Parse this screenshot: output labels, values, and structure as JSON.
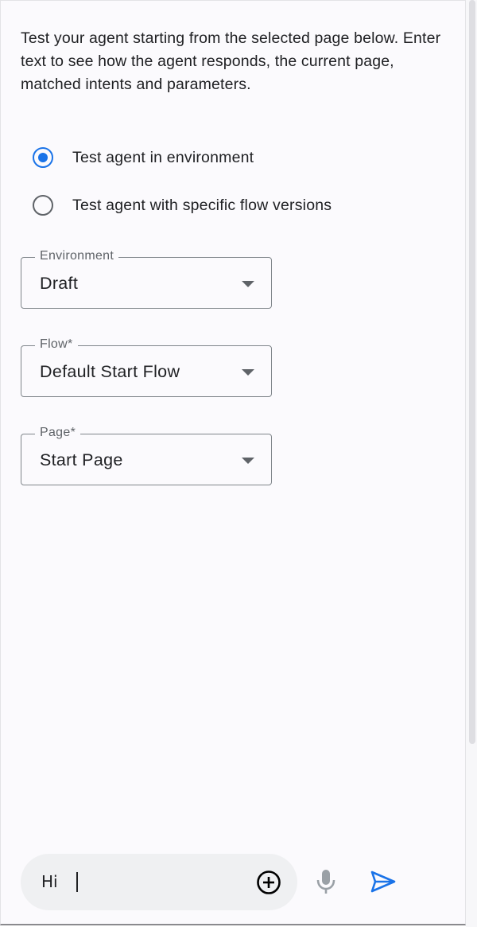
{
  "intro_text": "Test your agent starting from the selected page below. Enter text to see how the agent responds, the current page, matched intents and parameters.",
  "test_mode": {
    "options": [
      {
        "label": "Test agent in environment",
        "selected": true
      },
      {
        "label": "Test agent with specific flow versions",
        "selected": false
      }
    ]
  },
  "selects": {
    "environment": {
      "label": "Environment",
      "value": "Draft"
    },
    "flow": {
      "label": "Flow*",
      "value": "Default Start Flow"
    },
    "page": {
      "label": "Page*",
      "value": "Start Page"
    }
  },
  "composer": {
    "input_value": "Hi",
    "icons": {
      "add": "add-circle-icon",
      "mic": "mic-icon",
      "send": "send-icon"
    }
  },
  "colors": {
    "accent": "#1a73e8",
    "panel_background": "#fbfafd",
    "composer_background": "#eff0f2",
    "text": "#202124",
    "muted": "#5f6368"
  }
}
